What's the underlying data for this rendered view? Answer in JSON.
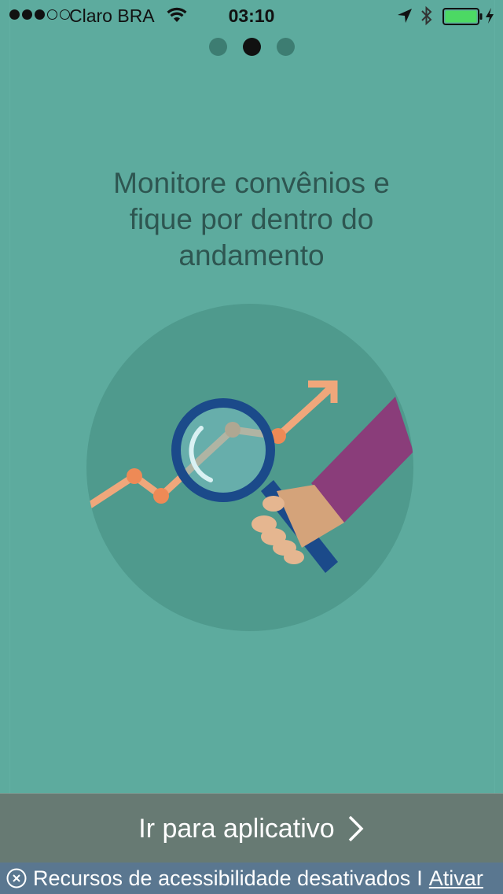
{
  "status_bar": {
    "carrier": "Claro BRA",
    "time": "03:10",
    "signal_strength": 3,
    "signal_total": 5,
    "battery_color": "#4cd964"
  },
  "pager": {
    "total": 3,
    "active_index": 1
  },
  "onboarding": {
    "headline_lines": [
      "Monitore convênios e",
      "fique por dentro do",
      "andamento"
    ],
    "illustration_icon": "magnifier-chart-icon"
  },
  "cta": {
    "label": "Ir para aplicativo",
    "icon": "chevron-right-icon"
  },
  "accessibility_bar": {
    "message": "Recursos de acessibilidade desativados",
    "separator": "I",
    "action": "Ativar"
  },
  "colors": {
    "background": "#5dab9e",
    "headline": "#2e5651",
    "cta_background": "#677a73",
    "a11y_background": "#5a7790"
  }
}
